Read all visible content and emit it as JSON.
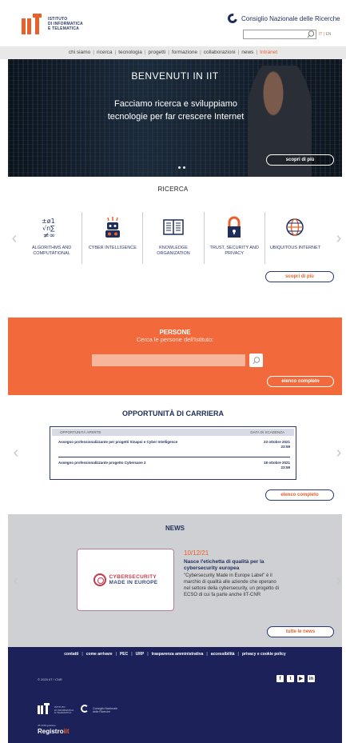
{
  "header": {
    "logo_lines": [
      "ISTITUTO",
      "DI INFORMATICA",
      "E TELEMATICA"
    ],
    "cnr_name": "Consiglio Nazionale delle Ricerche",
    "search_placeholder": "",
    "lang_it": "IT",
    "lang_sep": "|",
    "lang_en": "EN"
  },
  "nav": {
    "items": [
      "chi siamo",
      "ricerca",
      "tecnologia",
      "progetti",
      "formazione",
      "collaborazioni",
      "news"
    ],
    "intranet": "Intranet",
    "separator": "|"
  },
  "hero": {
    "title": "BENVENUTI IN IIT",
    "text": "Facciamo ricerca e sviluppiamo tecnologie per far crescere Internet",
    "button": "scopri di più"
  },
  "ricerca": {
    "title": "RICERCA",
    "items": [
      {
        "label": "ALGORITHMS AND COMPUTATIONAL",
        "icon": "math-symbols-icon"
      },
      {
        "label": "CYBER INTELLIGENCE",
        "icon": "robot-icon"
      },
      {
        "label": "KNOWLEDGE ORGANIZATION",
        "icon": "open-book-icon"
      },
      {
        "label": "TRUST, SECURITY AND PRIVACY",
        "icon": "padlock-icon"
      },
      {
        "label": "UBIQUITOUS INTERNET",
        "icon": "globe-icon"
      }
    ],
    "button": "scopri di più",
    "left_arrow": "‹",
    "right_arrow": "›"
  },
  "persone": {
    "title": "PERSONE",
    "subtitle": "Cerca le persone dell'Istituto:",
    "input_placeholder": "",
    "button": "elenco completo"
  },
  "carriera": {
    "title": "OPPORTUNITÀ DI CARRIERA",
    "col_left": "OPPORTUNITÀ APERTE",
    "col_right": "DATA DI SCADENZA",
    "rows": [
      {
        "title": "Assegno professionalizzante per progetti Sinapsi e Cyber Intelligence",
        "date": "23 ottobre 2021",
        "time": "23:59"
      },
      {
        "title": "Assegno professionalizzante progetto Cybersane 2",
        "date": "18 ottobre 2021",
        "time": "23:59"
      }
    ],
    "button": "elenco completo"
  },
  "news": {
    "title": "NEWS",
    "card_line1": "CYBERSECURITY",
    "card_line2": "MADE IN EUROPE",
    "date": "10/12/21",
    "headline": "Nasce l'etichetta di qualità per la cybersecurity europea",
    "body": "\"Cybersecurity Made in Europe Label\" è il marchio di qualità alle aziende che operano nel settore della cybersecurity, un progetto di ECSO di cui fa parte anche IIT-CNR",
    "button": "tutte le news"
  },
  "footer": {
    "links": [
      "contatti",
      "come arrivare",
      "PEC",
      "URP",
      "trasparenza amministrativa",
      "accessibilità",
      "privacy e cookie policy"
    ],
    "separator": "|",
    "copyright": "© 2020 IIT / CNR",
    "socials": [
      "f",
      "t",
      "▶",
      "in"
    ],
    "iit_name_lines": [
      "ISTITUTO",
      "DI INFORMATICA",
      "E TELEMATICA"
    ],
    "cnr_name_lines": [
      "Consiglio Nazionale",
      "delle Ricerche"
    ],
    "registro_pre": "IIT-CNR gestisce",
    "registro": "Registro"
  },
  "colors": {
    "accent_orange": "#e8602c",
    "persone_bg": "#f26a3b",
    "navy": "#1c2259",
    "news_bg": "#cfd0d4"
  }
}
